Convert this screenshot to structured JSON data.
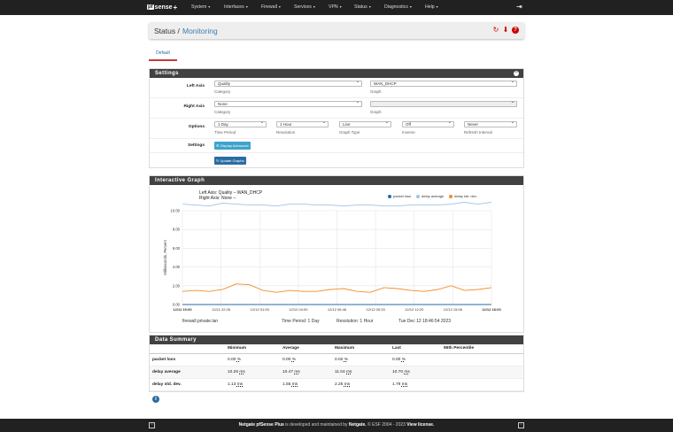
{
  "brand": {
    "name": "sense",
    "pf": "pf",
    "plus": "+"
  },
  "nav": [
    "System",
    "Interfaces",
    "Firewall",
    "Services",
    "VPN",
    "Status",
    "Diagnostics",
    "Help"
  ],
  "breadcrumb": {
    "section": "Status",
    "page": "Monitoring"
  },
  "tabs": [
    {
      "label": "Default"
    }
  ],
  "settings": {
    "heading": "Settings",
    "left_axis_label": "Left Axis",
    "left_category_value": "Quality",
    "left_category_help": "Category",
    "left_graph_value": "WAN_DHCP",
    "left_graph_help": "Graph",
    "right_axis_label": "Right Axis",
    "right_category_value": "None",
    "right_category_help": "Category",
    "right_graph_value": "",
    "right_graph_help": "Graph",
    "options_label": "Options",
    "time_period_value": "1 Day",
    "time_period_help": "Time Period",
    "resolution_value": "1 Hour",
    "resolution_help": "Resolution",
    "graph_type_value": "Line",
    "graph_type_help": "Graph Type",
    "inverse_value": "Off",
    "inverse_help": "Inverse",
    "refresh_value": "Never",
    "refresh_help": "Refresh Interval",
    "settings_label": "Settings",
    "advanced_button": "Display Advanced",
    "update_button": "Update Graphs"
  },
  "graph": {
    "heading": "Interactive Graph",
    "left_axis_title": "Left Axis: Quality – WAN_DHCP",
    "right_axis_title": "Right Axis: None –",
    "hostname": "firewall.private.lan",
    "time_period": "Time Period: 1 Day",
    "resolution": "Resolution: 1 Hour",
    "timestamp": "Tue Dec 12 18:46:54 2023"
  },
  "chart_data": {
    "type": "line",
    "ylabel": "Milliseconds, Percent",
    "ylim": [
      0,
      10
    ],
    "yticks": [
      "0.00",
      "2.00",
      "4.00",
      "6.00",
      "8.00",
      "10.00"
    ],
    "xticks": [
      "12/11 19:00",
      "12/11 22:26",
      "12/12 01:53",
      "12/12 04:00",
      "12/12 06:46",
      "12/12 09:33",
      "12/12 12:20",
      "12/12 15:06",
      "12/12 18:00"
    ],
    "series": [
      {
        "name": "packet loss",
        "color": "#2a6aa4",
        "values": [
          0,
          0,
          0,
          0,
          0,
          0,
          0,
          0,
          0,
          0,
          0,
          0,
          0,
          0,
          0,
          0,
          0,
          0,
          0,
          0,
          0,
          0,
          0,
          0
        ]
      },
      {
        "name": "delay average",
        "color": "#9fc5e8",
        "values": [
          10.7,
          10.6,
          10.5,
          10.8,
          10.7,
          10.6,
          10.6,
          10.5,
          10.7,
          10.7,
          10.6,
          10.6,
          10.5,
          10.6,
          10.6,
          10.5,
          10.5,
          10.6,
          10.6,
          10.6,
          10.7,
          10.9,
          10.7,
          10.9
        ]
      },
      {
        "name": "delay std. dev.",
        "color": "#f28c28",
        "values": [
          1.4,
          1.5,
          1.4,
          1.6,
          2.2,
          2.1,
          1.5,
          1.3,
          1.5,
          1.4,
          1.4,
          1.6,
          1.7,
          1.4,
          1.3,
          1.8,
          1.7,
          1.5,
          1.4,
          1.6,
          2.0,
          1.5,
          1.6,
          1.8
        ]
      }
    ]
  },
  "data_summary": {
    "heading": "Data Summary",
    "columns": [
      "",
      "Minimum",
      "Average",
      "Maximum",
      "Last",
      "95th Percentile"
    ],
    "rows": [
      {
        "name": "packet loss",
        "min": "0.00",
        "min_u": "%",
        "avg": "0.00",
        "avg_u": "%",
        "max": "0.02",
        "max_u": "%",
        "last": "0.00",
        "last_u": "%"
      },
      {
        "name": "delay average",
        "min": "10.26",
        "min_u": "ms",
        "avg": "10.47",
        "avg_u": "ms",
        "max": "11.04",
        "max_u": "ms",
        "last": "10.70",
        "last_u": "ms"
      },
      {
        "name": "delay std. dev.",
        "min": "1.13",
        "min_u": "ms",
        "avg": "1.55",
        "avg_u": "ms",
        "max": "2.25",
        "max_u": "ms",
        "last": "1.79",
        "last_u": "ms"
      }
    ]
  },
  "footer": {
    "product": "Netgate pfSense Plus",
    "middle": " is developed and maintained by ",
    "company": "Netgate.",
    "copyright": " © ESF 2004 - 2023 ",
    "license": "View license."
  }
}
